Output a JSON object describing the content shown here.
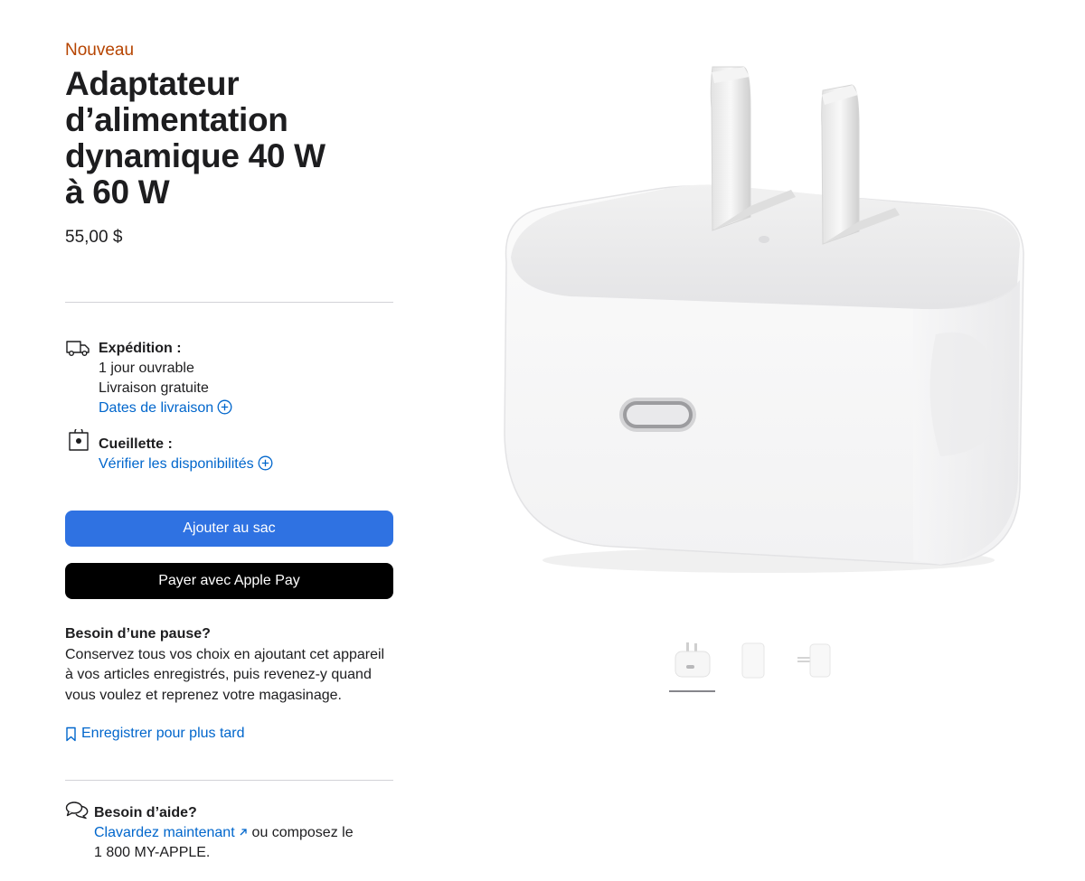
{
  "product": {
    "eyebrow": "Nouveau",
    "title_lines": [
      "Adaptateur",
      "d’alimentation",
      "dynamique 40 W",
      "à 60 W"
    ],
    "price": "55,00 $"
  },
  "shipping": {
    "label": "Expédition :",
    "line1": "1 jour ouvrable",
    "line2": "Livraison gratuite",
    "link": "Dates de livraison",
    "icon": "truck-icon"
  },
  "pickup": {
    "label": "Cueillette :",
    "link": "Vérifier les disponibilités",
    "icon": "store-bag-icon"
  },
  "actions": {
    "add_to_bag": "Ajouter au sac",
    "apple_pay": "Payer avec Apple Pay"
  },
  "pause": {
    "heading": "Besoin d’une pause?",
    "body": "Conservez tous vos choix en ajoutant cet appareil à vos articles enregistrés, puis revenez-y quand vous voulez et reprenez votre magasinage.",
    "save_link": "Enregistrer pour plus tard"
  },
  "help": {
    "heading": "Besoin d’aide?",
    "chat_link": "Clavardez maintenant",
    "chat_suffix": " ou composez le",
    "phone": "1 800 MY-APPLE."
  },
  "gallery": {
    "selected_index": 0,
    "thumbnails": [
      "front",
      "side",
      "profile"
    ]
  },
  "colors": {
    "eyebrow": "#b64400",
    "link": "#0066cc",
    "add_to_bag_bg": "#2f72e2",
    "apple_pay_bg": "#000000"
  }
}
